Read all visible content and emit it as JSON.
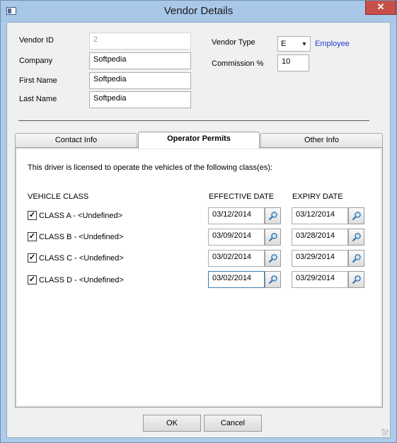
{
  "window": {
    "title": "Vendor Details",
    "close_glyph": "✕"
  },
  "vendor": {
    "id_label": "Vendor ID",
    "id_value": "2",
    "company_label": "Company",
    "company_value": "Softpedia",
    "first_name_label": "First Name",
    "first_name_value": "Softpedia",
    "last_name_label": "Last Name",
    "last_name_value": "Softpedia",
    "type_label": "Vendor Type",
    "type_value": "E",
    "type_description": "Employee",
    "commission_label": "Commission %",
    "commission_value": "10"
  },
  "tabs": [
    {
      "label": "Contact Info",
      "active": false
    },
    {
      "label": "Operator Permits",
      "active": true
    },
    {
      "label": "Other Info",
      "active": false
    }
  ],
  "permits": {
    "intro": "This driver is licensed to operate the vehicles of the following class(es):",
    "col_vehicle_class": "VEHICLE CLASS",
    "col_effective_date": "EFFECTIVE DATE",
    "col_expiry_date": "EXPIRY DATE",
    "check_glyph": "✓",
    "rows": [
      {
        "label": "CLASS A - <Undefined>",
        "checked": true,
        "effective": "03/12/2014",
        "expiry": "03/12/2014"
      },
      {
        "label": "CLASS B - <Undefined>",
        "checked": true,
        "effective": "03/09/2014",
        "expiry": "03/28/2014"
      },
      {
        "label": "CLASS C - <Undefined>",
        "checked": true,
        "effective": "03/02/2014",
        "expiry": "03/29/2014"
      },
      {
        "label": "CLASS D - <Undefined>",
        "checked": true,
        "effective": "03/02/2014",
        "expiry": "03/29/2014"
      }
    ]
  },
  "buttons": {
    "ok": "OK",
    "cancel": "Cancel"
  },
  "icons": {
    "date_picker": "magnifier-icon",
    "dropdown": "chevron-down-icon"
  },
  "colors": {
    "titlebar": "#a9c7e8",
    "close": "#c7504a",
    "link": "#1f3fd0"
  }
}
